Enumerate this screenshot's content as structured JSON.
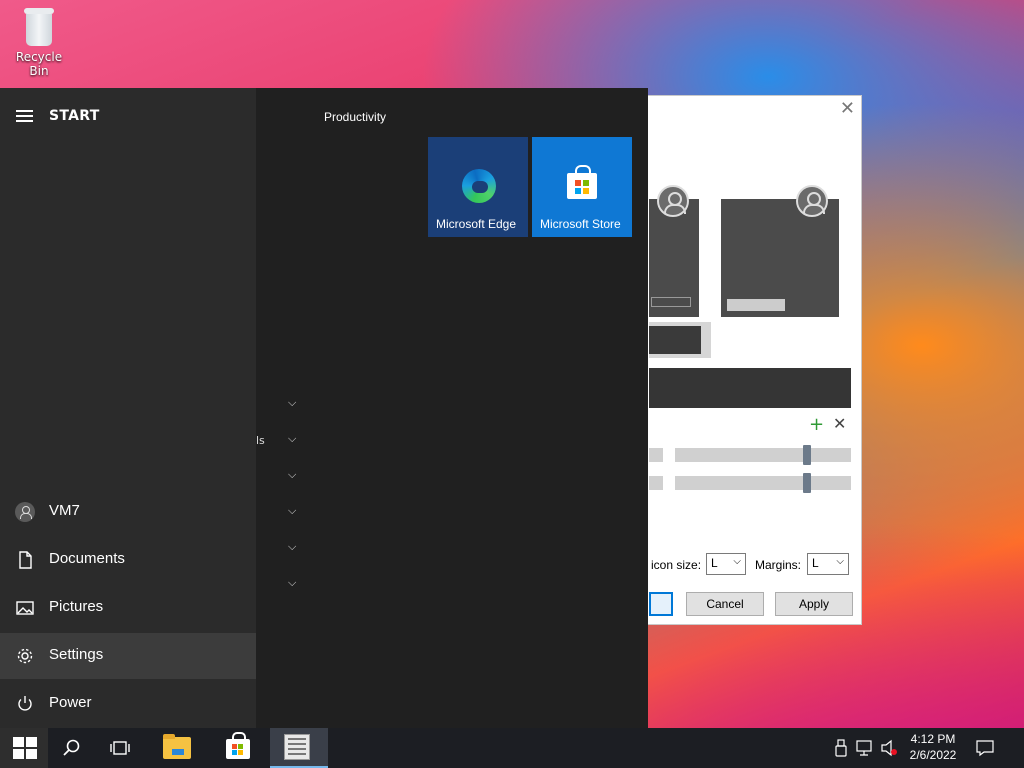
{
  "desktop": {
    "icons": [
      {
        "label": "Recycle Bin",
        "icon": "recycle-bin-icon"
      }
    ]
  },
  "start_menu": {
    "title": "START",
    "left_items": [
      {
        "label": "VM7",
        "icon": "user-avatar-icon"
      },
      {
        "label": "Documents",
        "icon": "document-icon"
      },
      {
        "label": "Pictures",
        "icon": "pictures-icon"
      },
      {
        "label": "Settings",
        "icon": "gear-icon"
      },
      {
        "label": "Power",
        "icon": "power-icon"
      }
    ],
    "partial_letter": "ls",
    "group_title": "Productivity",
    "tiles": [
      {
        "label": "Microsoft Edge",
        "icon": "edge-icon",
        "color": "#1b3f78"
      },
      {
        "label": "Microsoft Store",
        "icon": "store-icon",
        "color": "#0f78d4"
      }
    ]
  },
  "bg_window": {
    "close_label": "✕",
    "icon_size_label": "icon size:",
    "icon_size_value": "L",
    "margins_label": "Margins:",
    "margins_value": "L",
    "buttons": {
      "cancel": "Cancel",
      "apply": "Apply"
    }
  },
  "taskbar": {
    "time": "4:12 PM",
    "date": "2/6/2022"
  },
  "colors": {
    "start_bg": "#202020",
    "start_left_bg": "#2b2b2b",
    "accent": "#0078d7"
  }
}
